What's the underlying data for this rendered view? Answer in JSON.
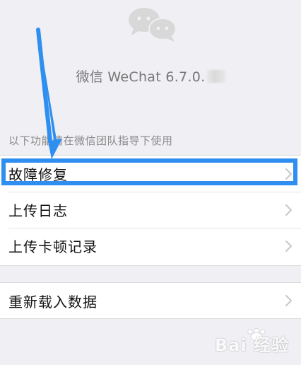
{
  "app": {
    "version_text": "微信 WeChat 6.7.0."
  },
  "section": {
    "title": "以下功能请在微信团队指导下使用"
  },
  "menu": {
    "items": [
      {
        "label": "故障修复"
      },
      {
        "label": "上传日志"
      },
      {
        "label": "上传卡顿记录"
      }
    ],
    "reload": {
      "label": "重新载入数据"
    }
  },
  "watermark": {
    "text": "Bai 经验"
  },
  "icons": {
    "logo": "wechat-logo-icon",
    "chevron": "chevron-right-icon",
    "annotation": "down-arrow-icon"
  },
  "colors": {
    "background": "#efeff4",
    "highlight": "#2f8ff0",
    "text_primary": "#111111",
    "text_secondary": "#8a8a8a"
  }
}
